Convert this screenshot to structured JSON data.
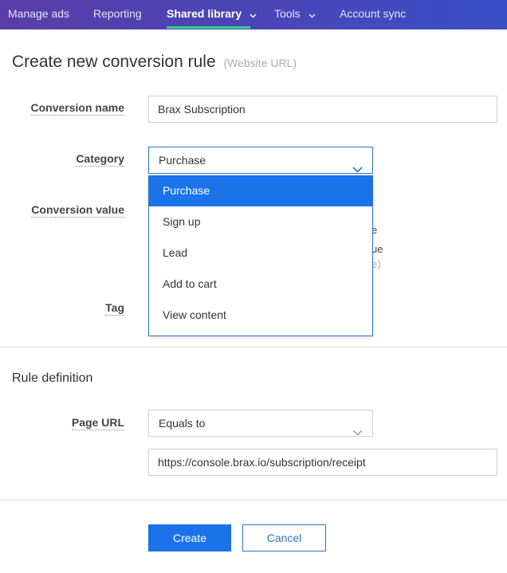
{
  "nav": {
    "items": [
      {
        "label": "Manage ads"
      },
      {
        "label": "Reporting"
      },
      {
        "label": "Shared library"
      },
      {
        "label": "Tools"
      },
      {
        "label": "Account sync"
      }
    ],
    "active_index": 2,
    "underline_color": "#2dd08a"
  },
  "page": {
    "title": "Create new conversion rule",
    "subtitle": "(Website URL)"
  },
  "form": {
    "conversion_name_label": "Conversion name",
    "conversion_name_value": "Brax Subscription",
    "category_label": "Category",
    "category_value": "Purchase",
    "category_options": [
      "Purchase",
      "Sign up",
      "Lead",
      "Add to cart",
      "View content"
    ],
    "conversion_value_label": "Conversion value",
    "tag_label": "Tag",
    "hidden_fragments": [
      "e",
      "ue",
      "e)"
    ]
  },
  "rule": {
    "section_title": "Rule definition",
    "page_url_label": "Page URL",
    "operator_value": "Equals to",
    "url_value": "https://console.brax.io/subscription/receipt"
  },
  "actions": {
    "create_label": "Create",
    "cancel_label": "Cancel"
  },
  "colors": {
    "primary": "#1a73e8",
    "focus_border": "#2b74c8"
  },
  "icons": {
    "nav_chevron": "chevron-down-icon",
    "select_caret": "chevron-down-icon"
  }
}
